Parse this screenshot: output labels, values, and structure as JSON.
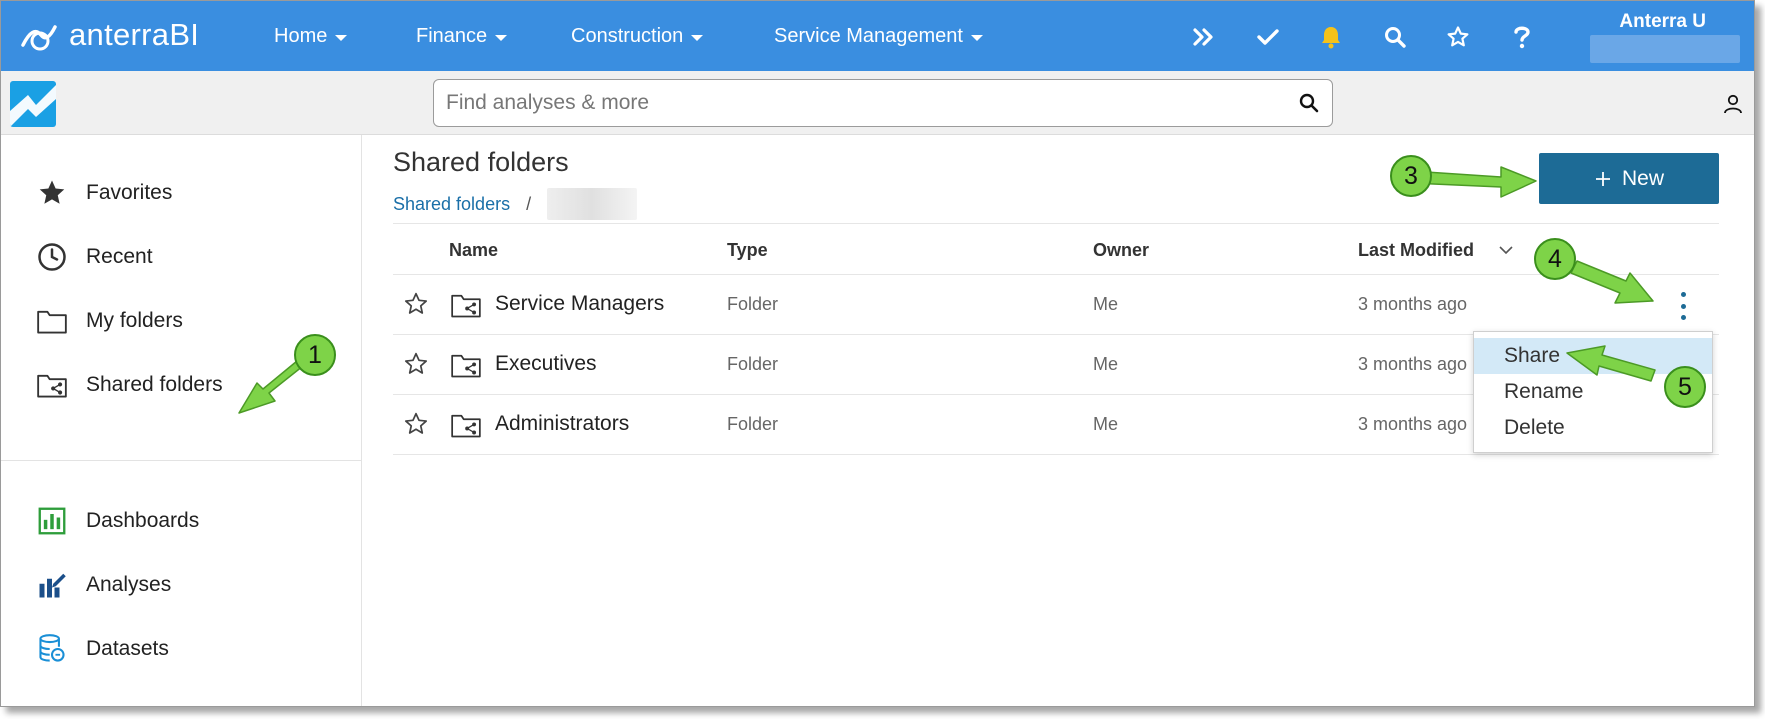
{
  "app": {
    "brand": "anterraBI"
  },
  "topnav": {
    "items": [
      {
        "label": "Home"
      },
      {
        "label": "Finance"
      },
      {
        "label": "Construction"
      },
      {
        "label": "Service Management"
      }
    ],
    "user_name": "Anterra U"
  },
  "search": {
    "placeholder": "Find analyses & more"
  },
  "sidebar": {
    "items": [
      {
        "label": "Favorites",
        "icon": "star-icon"
      },
      {
        "label": "Recent",
        "icon": "clock-icon"
      },
      {
        "label": "My folders",
        "icon": "folder-icon"
      },
      {
        "label": "Shared folders",
        "icon": "shared-folder-icon"
      },
      {
        "label": "Dashboards",
        "icon": "dashboard-icon"
      },
      {
        "label": "Analyses",
        "icon": "analyses-icon"
      },
      {
        "label": "Datasets",
        "icon": "datasets-icon"
      }
    ]
  },
  "main": {
    "title": "Shared folders",
    "breadcrumb": {
      "link": "Shared folders",
      "separator": "/"
    },
    "new_button": "New"
  },
  "table": {
    "headers": {
      "name": "Name",
      "type": "Type",
      "owner": "Owner",
      "modified": "Last Modified"
    },
    "rows": [
      {
        "name": "Service Managers",
        "type": "Folder",
        "owner": "Me",
        "modified": "3 months ago"
      },
      {
        "name": "Executives",
        "type": "Folder",
        "owner": "Me",
        "modified": "3 months ago"
      },
      {
        "name": "Administrators",
        "type": "Folder",
        "owner": "Me",
        "modified": "3 months ago"
      }
    ]
  },
  "context_menu": {
    "items": [
      "Share",
      "Rename",
      "Delete"
    ],
    "highlighted": "Share"
  },
  "annotations": {
    "callouts": [
      "1",
      "3",
      "4",
      "5"
    ]
  },
  "colors": {
    "topbar": "#3a8ee0",
    "primary_button": "#1d6b96",
    "arrow": "#7ed348",
    "link": "#1a6fa8"
  }
}
